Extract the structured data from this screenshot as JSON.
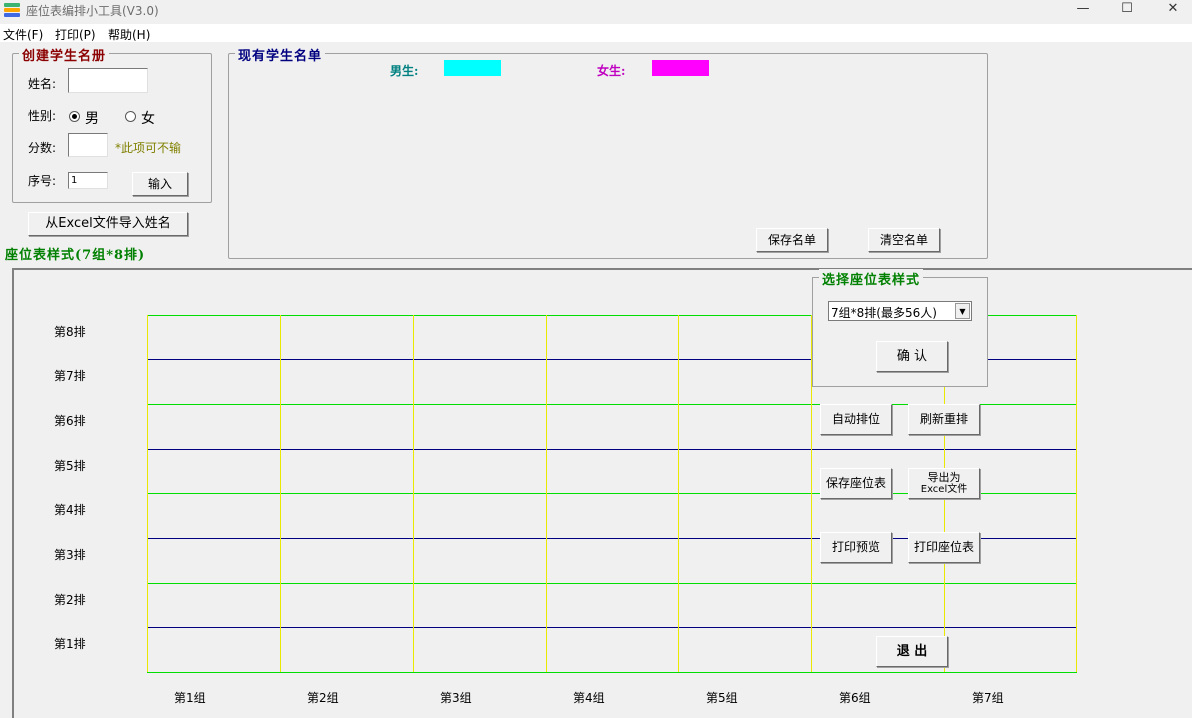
{
  "window": {
    "title": "座位表编排小工具(V3.0)",
    "minimize": "—",
    "maximize": "☐",
    "close": "✕"
  },
  "menu": [
    "文件(F)",
    "打印(P)",
    "帮助(H)"
  ],
  "create_roster": {
    "legend": "创建学生名册",
    "name_label": "姓名:",
    "name_value": "",
    "gender_label": "性别:",
    "male": "男",
    "female": "女",
    "score_label": "分数:",
    "score_value": "",
    "optional_hint": "*此项可不输",
    "index_label": "序号:",
    "index_value": "1",
    "input_button": "输入"
  },
  "import_button": "从Excel文件导入姓名",
  "roster": {
    "legend": "现有学生名单",
    "male_label": "男生:",
    "female_label": "女生:",
    "save_button": "保存名单",
    "clear_button": "清空名单"
  },
  "colors": {
    "male": "#00ffff",
    "female": "#ff00ff",
    "legend_red": "#8b0000",
    "legend_blue": "#000080",
    "legend_green": "#008000",
    "hint_olive": "#808000"
  },
  "seat_style_title": "座位表样式(7组*8排)",
  "rows": [
    "第8排",
    "第7排",
    "第6排",
    "第5排",
    "第4排",
    "第3排",
    "第2排",
    "第1排"
  ],
  "groups": [
    "第1组",
    "第2组",
    "第3组",
    "第4组",
    "第5组",
    "第6组",
    "第7组"
  ],
  "style_select": {
    "legend": "选择座位表样式",
    "selected": "7组*8排(最多56人)",
    "confirm": "确 认"
  },
  "actions": {
    "auto_arrange": "自动排位",
    "refresh": "刷新重排",
    "save_seat": "保存座位表",
    "export_line1": "导出为",
    "export_line2": "Excel文件",
    "print_preview": "打印预览",
    "print_seat": "打印座位表",
    "exit": "退 出"
  }
}
